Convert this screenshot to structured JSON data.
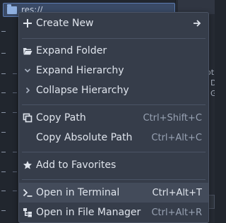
{
  "background": {
    "path_field": "res://",
    "right_panel_text": [
      "ot",
      "D",
      "G"
    ]
  },
  "menu": {
    "items": [
      {
        "id": "create_new",
        "label": "Create New",
        "shortcut": "",
        "icon": "plus-icon",
        "submenu": true
      },
      {
        "id": "expand_folder",
        "label": "Expand Folder",
        "shortcut": "",
        "icon": "folder-open-icon"
      },
      {
        "id": "expand_hierarchy",
        "label": "Expand Hierarchy",
        "shortcut": "",
        "icon": "chevron-down-icon"
      },
      {
        "id": "collapse_hierarchy",
        "label": "Collapse Hierarchy",
        "shortcut": "",
        "icon": "chevron-right-icon"
      },
      {
        "id": "copy_path",
        "label": "Copy Path",
        "shortcut": "Ctrl+Shift+C",
        "icon": "copy-icon"
      },
      {
        "id": "copy_absolute_path",
        "label": "Copy Absolute Path",
        "shortcut": "Ctrl+Alt+C",
        "icon": ""
      },
      {
        "id": "add_to_favorites",
        "label": "Add to Favorites",
        "shortcut": "",
        "icon": "star-icon"
      },
      {
        "id": "open_in_terminal",
        "label": "Open in Terminal",
        "shortcut": "Ctrl+Alt+T",
        "icon": "terminal-icon",
        "highlighted": true
      },
      {
        "id": "open_in_file_manager",
        "label": "Open in File Manager",
        "shortcut": "Ctrl+Alt+R",
        "icon": "file-manager-icon"
      }
    ]
  },
  "colors": {
    "menu_bg": "#363d4a",
    "menu_hover": "#434b5a",
    "text": "#dfe4ec",
    "shortcut_text": "#98a2b3"
  }
}
